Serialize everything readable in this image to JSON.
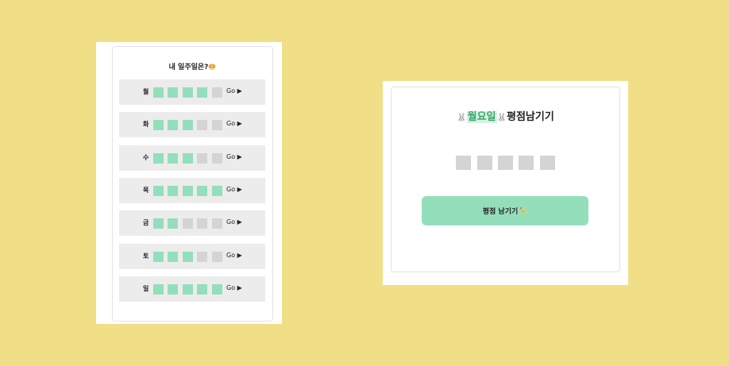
{
  "week_card": {
    "title": "내 일주일은?",
    "title_emoji": "🥯",
    "go_label": "Go ▶",
    "days": [
      {
        "label": "월",
        "filled": 4
      },
      {
        "label": "화",
        "filled": 3
      },
      {
        "label": "수",
        "filled": 3
      },
      {
        "label": "목",
        "filled": 5
      },
      {
        "label": "금",
        "filled": 2
      },
      {
        "label": "토",
        "filled": 3
      },
      {
        "label": "일",
        "filled": 5
      }
    ],
    "max_rating": 5
  },
  "rating_card": {
    "title_icon_left": "🐰",
    "title_highlight": "월요일",
    "title_icon_right": "🐰",
    "title_rest": "평점남기기",
    "stars": 5,
    "submit_label": "평점 남기기",
    "submit_emoji": "✏️"
  },
  "colors": {
    "background": "#f0df87",
    "filled": "#94dfbb",
    "empty": "#d4d4d4",
    "row_bg": "#ececec"
  }
}
